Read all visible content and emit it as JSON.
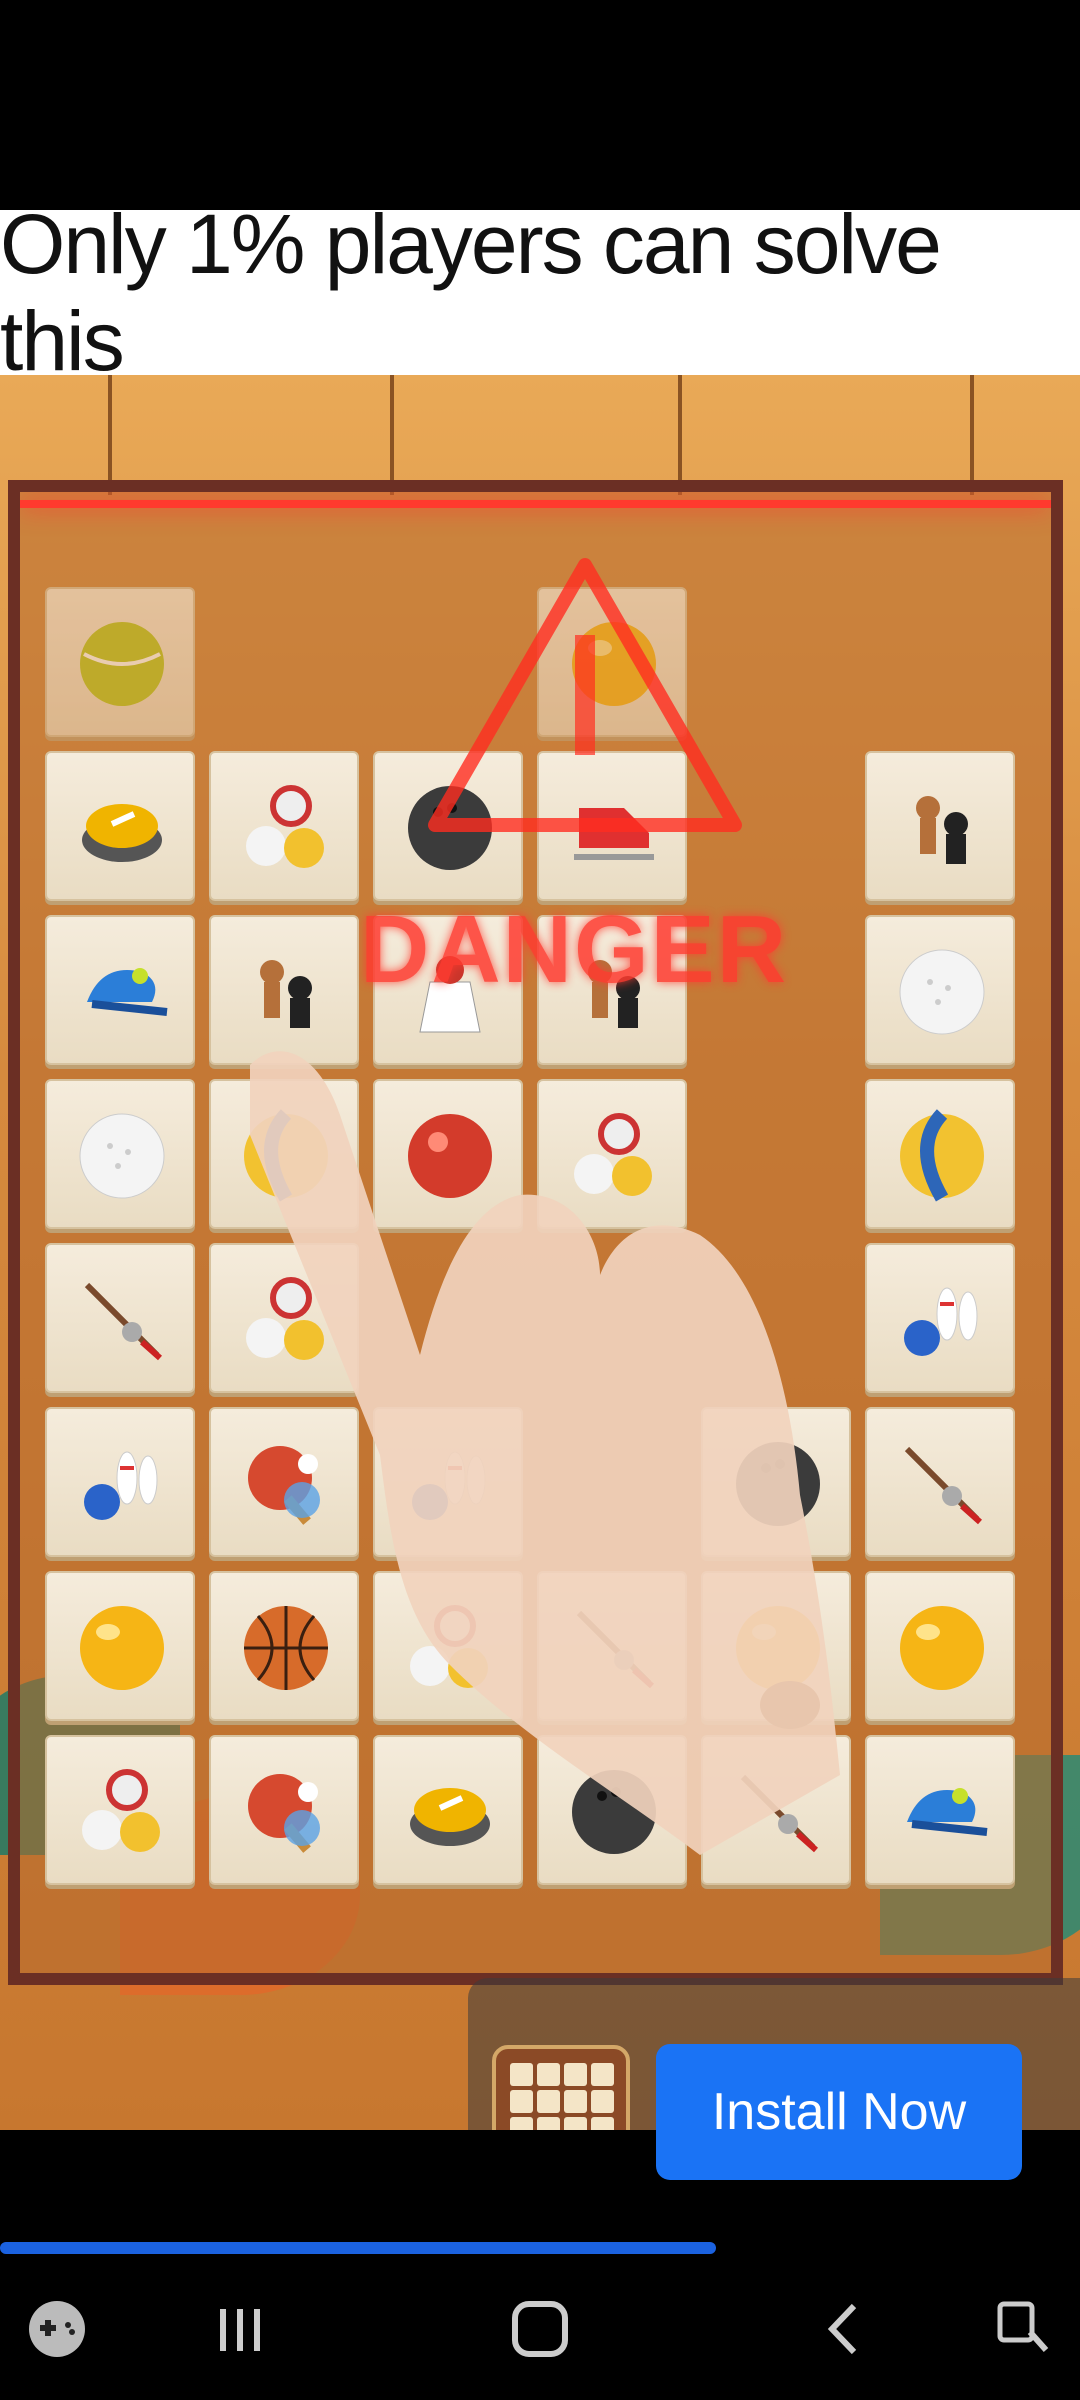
{
  "headline": "Only 1% players can solve this",
  "danger_label": "DANGER",
  "ad": {
    "install_label": "Install Now"
  },
  "progress": 0.663,
  "board": {
    "tiles": [
      {
        "row": 0,
        "col": 0,
        "icon": "tennis-ball-icon",
        "faded": true
      },
      {
        "row": 0,
        "col": 3,
        "icon": "orange-ball-icon",
        "faded": true
      },
      {
        "row": 1,
        "col": 0,
        "icon": "curling-stone-icon"
      },
      {
        "row": 1,
        "col": 1,
        "icon": "billiard-balls-icon"
      },
      {
        "row": 1,
        "col": 2,
        "icon": "bowling-ball-icon"
      },
      {
        "row": 1,
        "col": 3,
        "icon": "ice-skates-icon"
      },
      {
        "row": 1,
        "col": 5,
        "icon": "chess-pieces-icon"
      },
      {
        "row": 2,
        "col": 0,
        "icon": "cap-icon"
      },
      {
        "row": 2,
        "col": 1,
        "icon": "chess-pieces-icon"
      },
      {
        "row": 2,
        "col": 2,
        "icon": "shuttlecock-icon"
      },
      {
        "row": 2,
        "col": 3,
        "icon": "chess-pieces-icon"
      },
      {
        "row": 2,
        "col": 5,
        "icon": "golf-ball-icon"
      },
      {
        "row": 3,
        "col": 0,
        "icon": "golf-ball-icon"
      },
      {
        "row": 3,
        "col": 1,
        "icon": "volleyball-icon"
      },
      {
        "row": 3,
        "col": 2,
        "icon": "red-ball-icon"
      },
      {
        "row": 3,
        "col": 3,
        "icon": "billiard-balls-icon"
      },
      {
        "row": 3,
        "col": 5,
        "icon": "volleyball-icon"
      },
      {
        "row": 4,
        "col": 0,
        "icon": "fishing-rod-icon"
      },
      {
        "row": 4,
        "col": 1,
        "icon": "billiard-balls-icon"
      },
      {
        "row": 4,
        "col": 5,
        "icon": "bowling-pins-icon"
      },
      {
        "row": 5,
        "col": 0,
        "icon": "bowling-pins-icon"
      },
      {
        "row": 5,
        "col": 1,
        "icon": "ping-pong-paddle-icon"
      },
      {
        "row": 5,
        "col": 2,
        "icon": "bowling-pins-icon"
      },
      {
        "row": 5,
        "col": 4,
        "icon": "bowling-ball-icon"
      },
      {
        "row": 5,
        "col": 5,
        "icon": "fishing-rod-icon"
      },
      {
        "row": 6,
        "col": 0,
        "icon": "orange-ball-icon"
      },
      {
        "row": 6,
        "col": 1,
        "icon": "basketball-icon"
      },
      {
        "row": 6,
        "col": 2,
        "icon": "billiard-balls-icon"
      },
      {
        "row": 6,
        "col": 3,
        "icon": "fishing-rod-icon"
      },
      {
        "row": 6,
        "col": 4,
        "icon": "orange-ball-icon"
      },
      {
        "row": 6,
        "col": 5,
        "icon": "orange-ball-icon"
      },
      {
        "row": 7,
        "col": 0,
        "icon": "billiard-balls-icon"
      },
      {
        "row": 7,
        "col": 1,
        "icon": "ping-pong-paddle-icon"
      },
      {
        "row": 7,
        "col": 2,
        "icon": "curling-stone-icon"
      },
      {
        "row": 7,
        "col": 3,
        "icon": "bowling-ball-icon"
      },
      {
        "row": 7,
        "col": 4,
        "icon": "fishing-rod-icon"
      },
      {
        "row": 7,
        "col": 5,
        "icon": "cap-icon"
      }
    ]
  },
  "navbar": {
    "items": [
      "game-controller-icon",
      "recents-icon",
      "home-icon",
      "back-icon",
      "screenshot-icon"
    ]
  }
}
